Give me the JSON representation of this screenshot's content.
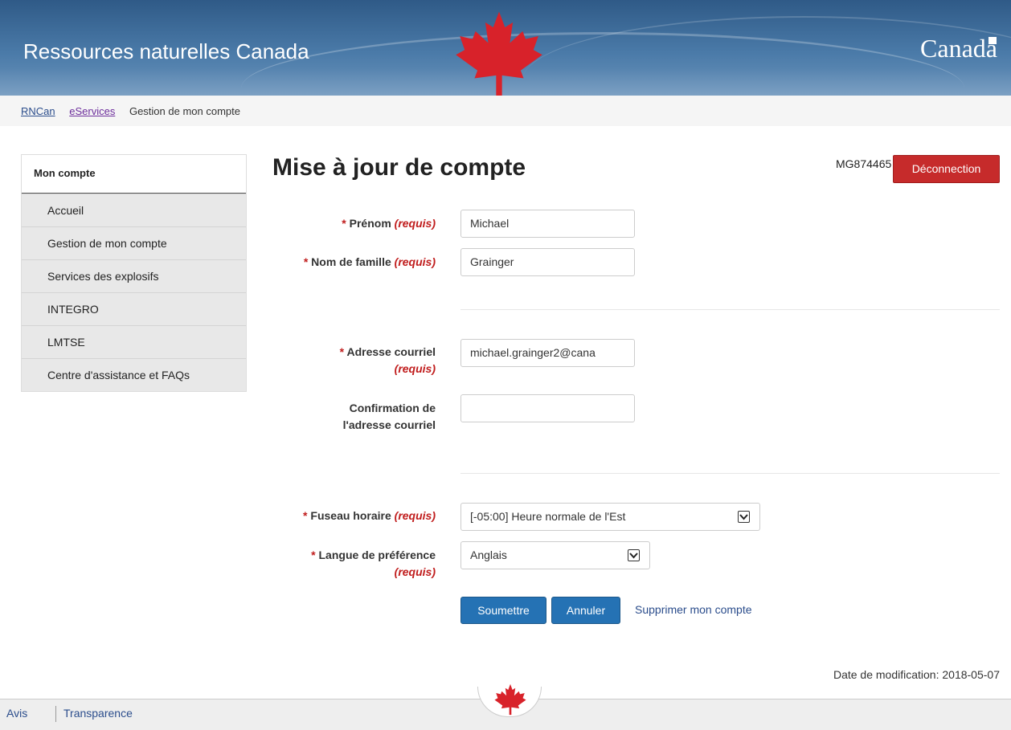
{
  "header": {
    "title": "Ressources naturelles Canada",
    "wordmark": "Canada",
    "flag_color": "#d8222a"
  },
  "breadcrumb": {
    "items": [
      "RNCan",
      "eServices"
    ],
    "current": "Gestion de mon compte"
  },
  "sidebar": {
    "heading": "Mon compte",
    "items": [
      "Accueil",
      "Gestion de mon compte",
      "Services des explosifs",
      "INTEGRO",
      "LMTSE",
      "Centre d'assistance et FAQs"
    ]
  },
  "main": {
    "title": "Mise à jour de compte",
    "account_id": "MG874465",
    "logout_label": "Déconnection",
    "required_marker": "*",
    "required_text": "(requis)",
    "fields": {
      "first_name_label": "Prénom",
      "first_name_value": "Michael",
      "last_name_label": "Nom de famille",
      "last_name_value": "Grainger",
      "email_label": "Adresse courriel",
      "email_value": "michael.grainger2@cana",
      "email_confirm_label_1": "Confirmation de",
      "email_confirm_label_2": "l'adresse courriel",
      "email_confirm_value": "",
      "timezone_label": "Fuseau horaire",
      "timezone_value": "[-05:00] Heure normale de l'Est",
      "language_label": "Langue de préférence",
      "language_value": "Anglais"
    },
    "buttons": {
      "submit": "Soumettre",
      "cancel": "Annuler",
      "delete_link": "Supprimer mon compte"
    },
    "date_modified": "Date de modification: 2018-05-07"
  },
  "footer": {
    "links": [
      "Avis",
      "Transparence"
    ]
  },
  "colors": {
    "banner": "#3b6898",
    "danger": "#c62b2b",
    "primary": "#2572b4",
    "required": "#c01c1c"
  }
}
